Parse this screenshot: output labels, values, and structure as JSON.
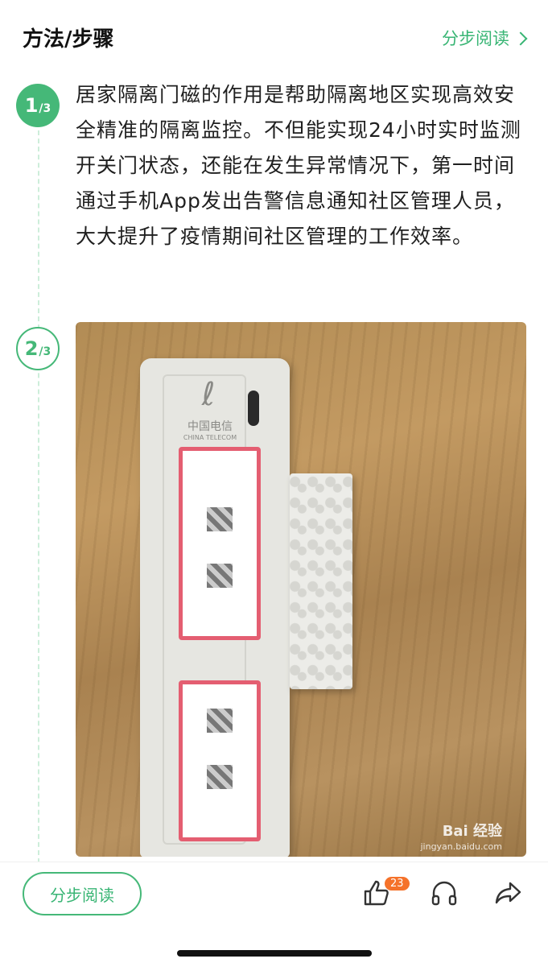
{
  "header": {
    "title": "方法/步骤",
    "step_read_link": "分步阅读"
  },
  "steps": [
    {
      "number": "1",
      "total": "/3",
      "text": "居家隔离门磁的作用是帮助隔离地区实现高效安全精准的隔离监控。不但能实现24小时实时监测开关门状态，还能在发生异常情况下，第一时间通过手机App发出告警信息通知社区管理人员，大大提升了疫情期间社区管理的工作效率。"
    },
    {
      "number": "2",
      "total": "/3"
    }
  ],
  "photo": {
    "brand": "中国电信",
    "brand_en": "CHINA TELECOM",
    "watermark": "Bai 经验",
    "watermark_url": "jingyan.baidu.com"
  },
  "footer": {
    "step_read_button": "分步阅读",
    "like_count": "23"
  },
  "colors": {
    "accent": "#45b878",
    "badge": "#f5722a"
  },
  "icons": [
    "chevron-right-icon",
    "thumbs-up-icon",
    "headphones-icon",
    "share-arrow-icon"
  ]
}
